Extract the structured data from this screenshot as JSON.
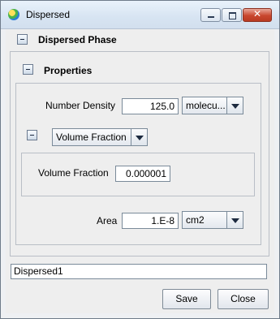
{
  "window": {
    "title": "Dispersed",
    "icon": "app-globe-icon",
    "close_glyph": "✕"
  },
  "dispersed_phase": {
    "header": "Dispersed Phase"
  },
  "properties": {
    "header": "Properties",
    "number_density": {
      "label": "Number Density",
      "value": "125.0",
      "unit": "molecu..."
    },
    "volume_fraction_section": {
      "mode_selected": "Volume Fraction",
      "volume_fraction": {
        "label": "Volume Fraction",
        "value": "0.000001"
      }
    },
    "area": {
      "label": "Area",
      "value": "1.E-8",
      "unit": "cm2"
    }
  },
  "name_field": {
    "value": "Dispersed1"
  },
  "buttons": {
    "save": "Save",
    "close": "Close"
  },
  "colors": {
    "title_bar": "#d7e4f2",
    "close_button": "#c9472f",
    "panel_bg": "#eeeeee"
  }
}
